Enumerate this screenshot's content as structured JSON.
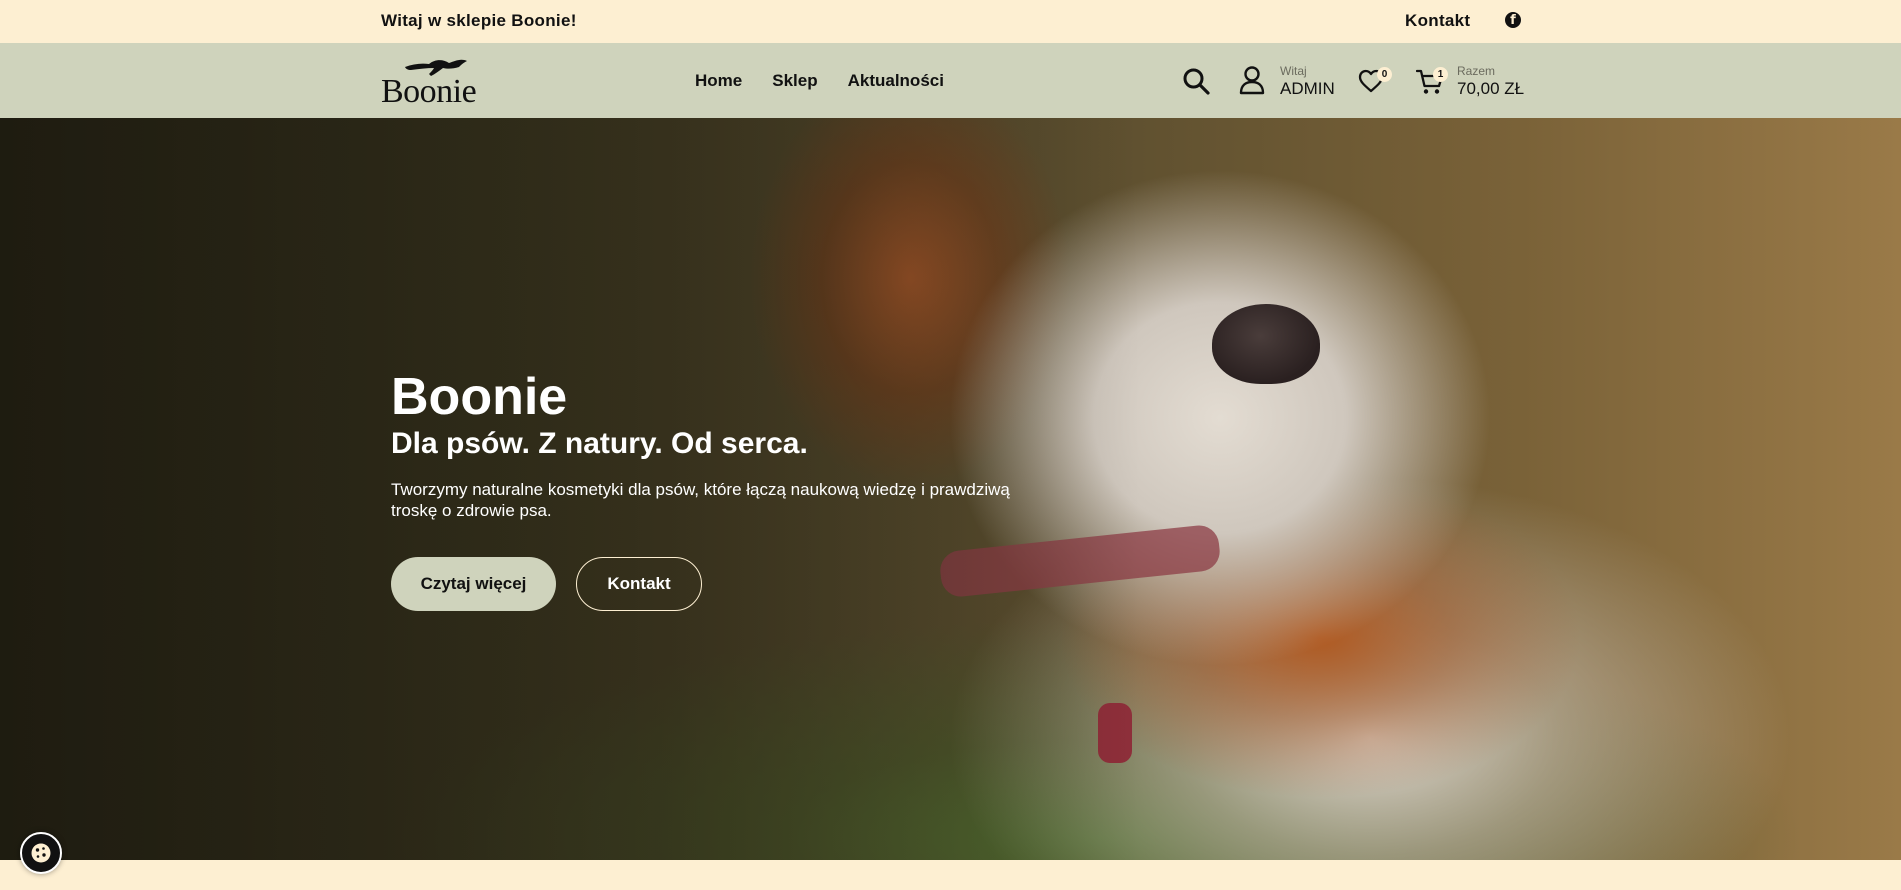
{
  "topbar": {
    "welcome": "Witaj w sklepie Boonie!",
    "contact": "Kontakt",
    "facebook_icon": "facebook-icon"
  },
  "header": {
    "logo_text": "Boonie",
    "nav": [
      {
        "label": "Home"
      },
      {
        "label": "Sklep"
      },
      {
        "label": "Aktualności"
      }
    ],
    "user": {
      "greeting": "Witaj",
      "name": "ADMIN"
    },
    "wishlist_count": "0",
    "cart": {
      "count": "1",
      "label": "Razem",
      "total": "70,00 ZŁ"
    }
  },
  "hero": {
    "title": "Boonie",
    "subtitle": "Dla psów. Z natury. Od serca.",
    "text": "Tworzymy naturalne kosmetyki dla psów, które łączą naukową wiedzę i prawdziwą troskę o zdrowie psa.",
    "primary_button": "Czytaj więcej",
    "secondary_button": "Kontakt"
  },
  "colors": {
    "topbar_bg": "#fdefd2",
    "header_bg": "#cfd3bc",
    "text": "#111111"
  }
}
